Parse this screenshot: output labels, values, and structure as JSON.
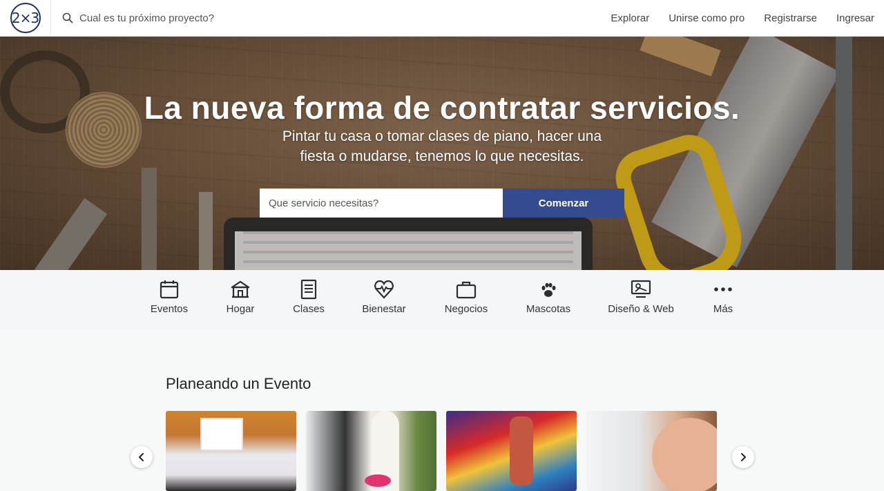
{
  "header": {
    "logo_text": "2×3",
    "search_placeholder": "Cual es tu próximo proyecto?",
    "nav": [
      {
        "label": "Explorar"
      },
      {
        "label": "Unirse como pro"
      },
      {
        "label": "Registrarse"
      },
      {
        "label": "Ingresar"
      }
    ]
  },
  "hero": {
    "title": "La nueva forma de contratar servicios.",
    "subtitle": "Pintar tu casa o tomar clases de piano, hacer una fiesta o mudarse, tenemos lo que necesitas.",
    "input_placeholder": "Que servicio necesitas?",
    "button_label": "Comenzar"
  },
  "categories": [
    {
      "label": "Eventos",
      "icon": "calendar-icon"
    },
    {
      "label": "Hogar",
      "icon": "house-icon"
    },
    {
      "label": "Clases",
      "icon": "document-icon"
    },
    {
      "label": "Bienestar",
      "icon": "heart-pulse-icon"
    },
    {
      "label": "Negocios",
      "icon": "briefcase-icon"
    },
    {
      "label": "Mascotas",
      "icon": "paw-icon"
    },
    {
      "label": "Diseño & Web",
      "icon": "monitor-icon"
    },
    {
      "label": "Más",
      "icon": "more-icon"
    }
  ],
  "section": {
    "title": "Planeando un Evento",
    "cards": [
      {
        "image": "dj-equipment-image"
      },
      {
        "image": "wedding-photographer-image"
      },
      {
        "image": "bounce-house-image"
      },
      {
        "image": "makeup-artist-image"
      }
    ]
  },
  "colors": {
    "brand_navy": "#1b2f5e",
    "button_blue": "#344c8f",
    "saw_yellow": "#f2c417"
  }
}
